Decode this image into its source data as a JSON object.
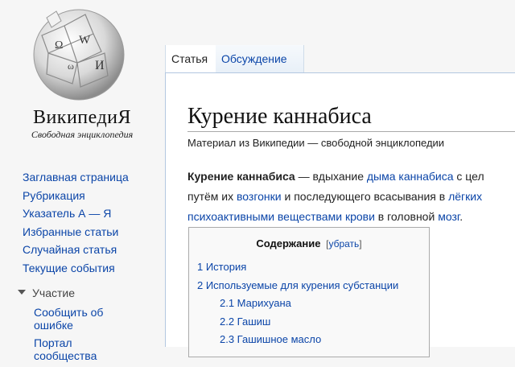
{
  "sidebar": {
    "wordmark": "ВикипедиЯ",
    "tagline": "Свободная энциклопедия",
    "nav": [
      "Заглавная страница",
      "Рубрикация",
      "Указатель А — Я",
      "Избранные статьи",
      "Случайная статья",
      "Текущие события"
    ],
    "section_title": "Участие",
    "section_items": [
      "Сообщить об ошибке",
      "Портал сообщества"
    ]
  },
  "tabs": {
    "article": "Статья",
    "talk": "Обсуждение"
  },
  "article": {
    "title": "Курение каннабиса",
    "subtitle": "Материал из Википедии — свободной энциклопедии",
    "lead": {
      "bold": "Курение каннабиса",
      "t1": " — вдыхание ",
      "link_smoke": "дыма",
      "t2": " ",
      "link_cannabis": "каннабиса",
      "t3": " с цел",
      "t4": "путём их ",
      "link_sublimation": "возгонки",
      "t5": " и последующего всасывания в ",
      "link_lungs": "лёгких",
      "link_psychoactive": "психоактивными веществами",
      "t6": " ",
      "link_blood": "крови",
      "t7": " в головной ",
      "link_brain": "мозг",
      "t8": "."
    }
  },
  "toc": {
    "title": "Содержание",
    "toggle_open": "[",
    "toggle_label": "убрать",
    "toggle_close": "]",
    "items": [
      "1 История",
      "2 Используемые для курения субстанции",
      "2.1 Марихуана",
      "2.2 Гашиш",
      "2.3 Гашишное масло"
    ]
  }
}
